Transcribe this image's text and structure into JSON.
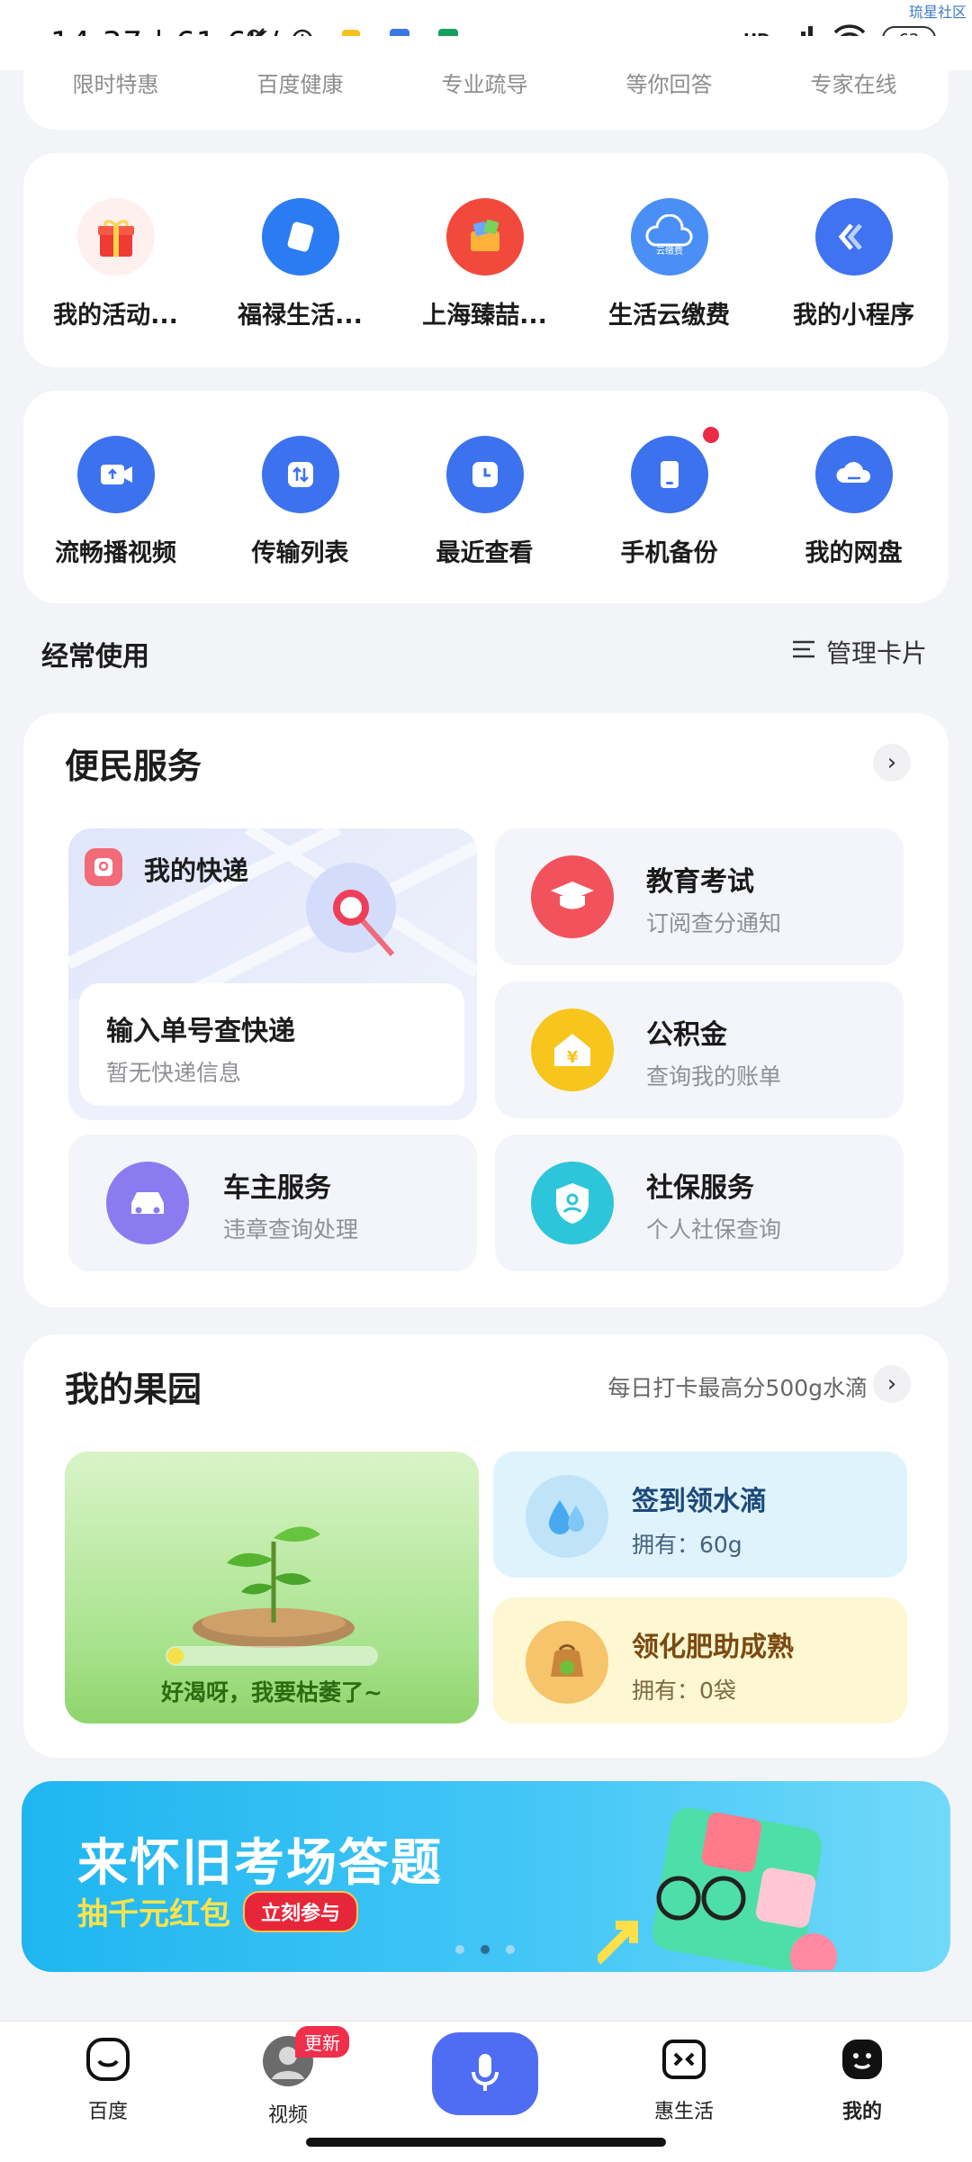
{
  "status_bar": {
    "time": "14:37",
    "speed": "61.6K/s",
    "network": "HD",
    "battery": "62",
    "watermark": "琉星社区"
  },
  "top_partial_labels": [
    "限时特惠",
    "百度健康",
    "专业疏导",
    "等你回答",
    "专家在线"
  ],
  "shortcuts_row1": [
    {
      "label": "我的活动...",
      "icon": "gift-icon",
      "color": "#f1f1f1"
    },
    {
      "label": "福禄生活...",
      "icon": "ticket-icon",
      "color": "#2b7bf3"
    },
    {
      "label": "上海臻喆...",
      "icon": "shopping-icon",
      "color": "#f14a3c"
    },
    {
      "label": "生活云缴费",
      "icon": "cloud-bill-icon",
      "color": "#4a8ff5"
    },
    {
      "label": "我的小程序",
      "icon": "mini-program-icon",
      "color": "#3f73f1"
    }
  ],
  "shortcuts_row2": [
    {
      "label": "流畅播视频",
      "icon": "video-upload-icon",
      "color": "#3d72ee"
    },
    {
      "label": "传输列表",
      "icon": "transfer-icon",
      "color": "#3d72ee"
    },
    {
      "label": "最近查看",
      "icon": "clock-icon",
      "color": "#3d72ee"
    },
    {
      "label": "手机备份",
      "icon": "phone-backup-icon",
      "color": "#3d72ee"
    },
    {
      "label": "我的网盘",
      "icon": "cloud-drive-icon",
      "color": "#3d72ee"
    }
  ],
  "frequent": {
    "title": "经常使用",
    "manage": "管理卡片"
  },
  "convenience": {
    "title": "便民服务",
    "express": {
      "title": "我的快递",
      "input_title": "输入单号查快递",
      "input_sub": "暂无快递信息"
    },
    "education": {
      "title": "教育考试",
      "sub": "订阅查分通知"
    },
    "fund": {
      "title": "公积金",
      "sub": "查询我的账单"
    },
    "car": {
      "title": "车主服务",
      "sub": "违章查询处理"
    },
    "social": {
      "title": "社保服务",
      "sub": "个人社保查询"
    }
  },
  "garden": {
    "title": "我的果园",
    "tip": "每日打卡最高分500g水滴",
    "message": "好渴呀，我要枯萎了~",
    "water": {
      "title": "签到领水滴",
      "sub": "拥有：60g"
    },
    "fertilizer": {
      "title": "领化肥助成熟",
      "sub": "拥有：0袋"
    }
  },
  "banner": {
    "title": "来怀旧考场答题",
    "sub": "抽千元红包",
    "button": "立刻参与"
  },
  "tabbar": {
    "items": [
      "百度",
      "视频",
      "惠生活",
      "我的"
    ],
    "update_badge": "更新"
  }
}
